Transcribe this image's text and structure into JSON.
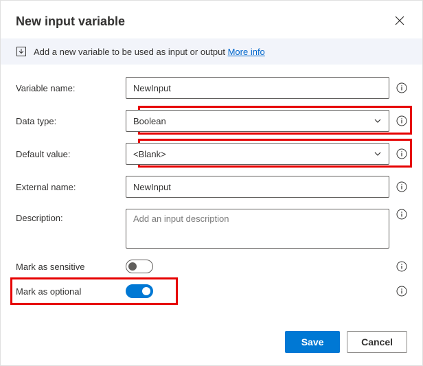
{
  "dialog": {
    "title": "New input variable",
    "info_text": "Add a new variable to be used as input or output",
    "more_info": "More info"
  },
  "fields": {
    "variable_name": {
      "label": "Variable name:",
      "value": "NewInput"
    },
    "data_type": {
      "label": "Data type:",
      "value": "Boolean"
    },
    "default_value": {
      "label": "Default value:",
      "value": "<Blank>"
    },
    "external_name": {
      "label": "External name:",
      "value": "NewInput"
    },
    "description": {
      "label": "Description:",
      "placeholder": "Add an input description",
      "value": ""
    },
    "mark_sensitive": {
      "label": "Mark as sensitive",
      "value": false
    },
    "mark_optional": {
      "label": "Mark as optional",
      "value": true
    }
  },
  "buttons": {
    "save": "Save",
    "cancel": "Cancel"
  }
}
